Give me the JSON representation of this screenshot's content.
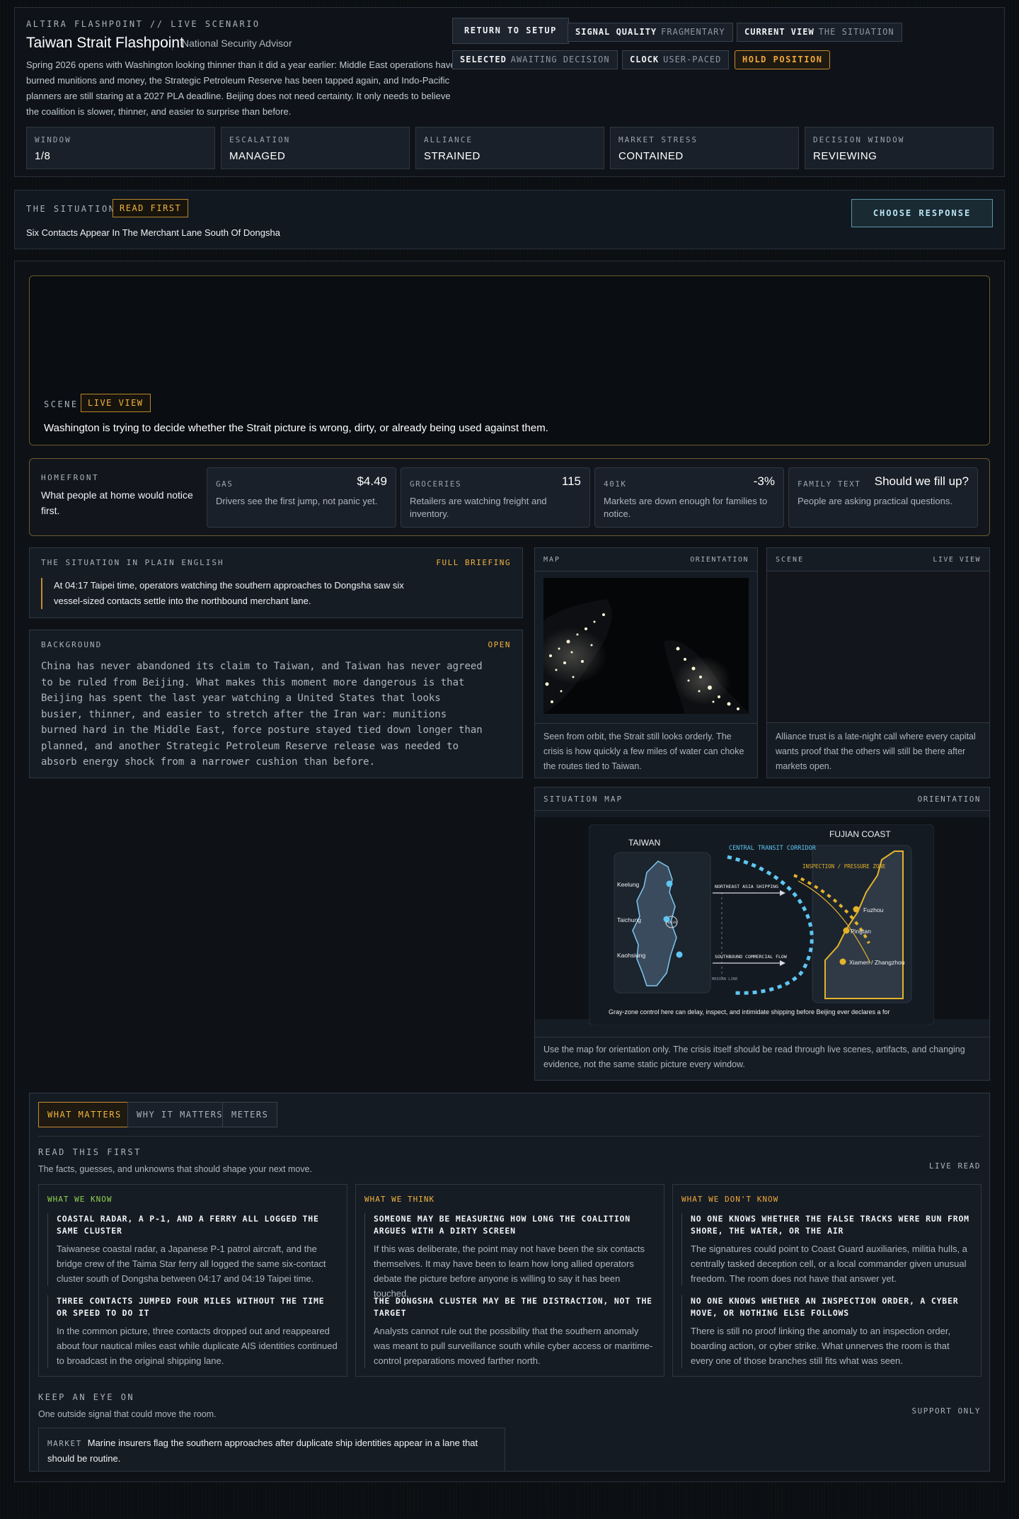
{
  "header": {
    "kicker": "ALTIRA FLASHPOINT // LIVE SCENARIO",
    "title": "Taiwan Strait Flashpoint",
    "role": "National Security Advisor",
    "intro": "Spring 2026 opens with Washington looking thinner than it did a year earlier: Middle East operations have burned munitions and money, the Strategic Petroleum Reserve has been tapped again, and Indo-Pacific planners are still staring at a 2027 PLA deadline. Beijing does not need certainty. It only needs to believe the coalition is slower, thinner, and easier to surprise than before.",
    "return_button": "RETURN TO SETUP",
    "chips": {
      "signal_quality": {
        "label": "SIGNAL QUALITY",
        "value": "FRAGMENTARY"
      },
      "current_view": {
        "label": "CURRENT VIEW",
        "value": "THE SITUATION"
      },
      "selected": {
        "label": "SELECTED",
        "value": "AWAITING DECISION"
      },
      "clock": {
        "label": "CLOCK",
        "value": "USER-PACED"
      }
    },
    "hold_button": "HOLD POSITION",
    "stats": [
      {
        "label": "WINDOW",
        "value": "1/8"
      },
      {
        "label": "ESCALATION",
        "value": "MANAGED"
      },
      {
        "label": "ALLIANCE",
        "value": "STRAINED"
      },
      {
        "label": "MARKET STRESS",
        "value": "CONTAINED"
      },
      {
        "label": "DECISION WINDOW",
        "value": "REVIEWING"
      }
    ]
  },
  "situation": {
    "label": "THE SITUATION",
    "tag": "READ FIRST",
    "headline": "Six Contacts Appear In The Merchant Lane South Of Dongsha",
    "choose_button": "CHOOSE RESPONSE"
  },
  "scene": {
    "label": "SCENE",
    "tag": "LIVE VIEW",
    "caption": "Washington is trying to decide whether the Strait picture is wrong, dirty, or already being used against them."
  },
  "homefront": {
    "label": "HOMEFRONT",
    "text": "What people at home would notice first.",
    "cards": [
      {
        "key": "GAS",
        "value": "$4.49",
        "desc": "Drivers see the first jump, not panic yet."
      },
      {
        "key": "GROCERIES",
        "value": "115",
        "desc": "Retailers are watching freight and inventory."
      },
      {
        "key": "401K",
        "value": "-3%",
        "desc": "Markets are down enough for families to notice."
      },
      {
        "key": "FAMILY TEXT",
        "value": "Should we fill up?",
        "desc": "People are asking practical questions."
      }
    ]
  },
  "plain_english": {
    "label": "THE SITUATION IN PLAIN ENGLISH",
    "link": "FULL BRIEFING",
    "text": "At 04:17 Taipei time, operators watching the southern approaches to Dongsha saw six vessel-sized contacts settle into the northbound merchant lane."
  },
  "background": {
    "label": "BACKGROUND",
    "link": "OPEN",
    "text": "China has never abandoned its claim to Taiwan, and Taiwan has never agreed to be ruled from Beijing. What makes this moment more dangerous is that Beijing has spent the last year watching a United States that looks busier, thinner, and easier to stretch after the Iran war: munitions burned hard in the Middle East, force posture stayed tied down longer than planned, and another Strategic Petroleum Reserve release was needed to absorb energy shock from a narrower cushion than before."
  },
  "map_card": {
    "label": "MAP",
    "right": "ORIENTATION",
    "caption": "Seen from orbit, the Strait still looks orderly. The crisis is how quickly a few miles of water can choke the routes tied to Taiwan."
  },
  "scene_card": {
    "label": "SCENE",
    "right": "LIVE VIEW",
    "caption": "Alliance trust is a late-night call where every capital wants proof that the others will still be there after markets open."
  },
  "situation_map": {
    "label": "SITUATION MAP",
    "right": "ORIENTATION",
    "taiwan": "TAIWAN",
    "fujian": "FUJIAN COAST",
    "corridor": "CENTRAL TRANSIT CORRIDOR",
    "inspection": "INSPECTION / PRESSURE ZONE",
    "ne_shipping": "NORTHEAST ASIA SHIPPING",
    "sb_shipping": "SOUTHBOUND COMMERCIAL FLOW",
    "median": "MEDIAN LINE",
    "penghu": "PENGHU",
    "cities_tw": [
      "Keelung",
      "Taichung",
      "Kaohsiung"
    ],
    "cities_cn": [
      "Fuzhou",
      "Pingtan",
      "Xiamen / Zhangzhou"
    ],
    "footer": "Gray-zone control here can delay, inspect, and intimidate shipping before Beijing ever declares a for",
    "caption": "Use the map for orientation only. The crisis itself should be read through live scenes, artifacts, and changing evidence, not the same static picture every window."
  },
  "tabs": [
    "WHAT MATTERS",
    "WHY IT MATTERS",
    "METERS"
  ],
  "read_first": {
    "title": "READ THIS FIRST",
    "sub": "The facts, guesses, and unknowns that should shape your next move.",
    "right": "LIVE READ"
  },
  "columns": [
    {
      "header": "WHAT WE KNOW",
      "color": "#8fd14f",
      "items": [
        {
          "title": "COASTAL RADAR, A P-1, AND A FERRY ALL LOGGED THE SAME CLUSTER",
          "body": "Taiwanese coastal radar, a Japanese P-1 patrol aircraft, and the bridge crew of the Taima Star ferry all logged the same six-contact cluster south of Dongsha between 04:17 and 04:19 Taipei time."
        },
        {
          "title": "THREE CONTACTS JUMPED FOUR MILES WITHOUT THE TIME OR SPEED TO DO IT",
          "body": "In the common picture, three contacts dropped out and reappeared about four nautical miles east while duplicate AIS identities continued to broadcast in the original shipping lane."
        }
      ]
    },
    {
      "header": "WHAT WE THINK",
      "color": "#f2b33c",
      "items": [
        {
          "title": "SOMEONE MAY BE MEASURING HOW LONG THE COALITION ARGUES WITH A DIRTY SCREEN",
          "body": "If this was deliberate, the point may not have been the six contacts themselves. It may have been to learn how long allied operators debate the picture before anyone is willing to say it has been touched."
        },
        {
          "title": "THE DONGSHA CLUSTER MAY BE THE DISTRACTION, NOT THE TARGET",
          "body": "Analysts cannot rule out the possibility that the southern anomaly was meant to pull surveillance south while cyber access or maritime-control preparations moved farther north."
        }
      ]
    },
    {
      "header": "WHAT WE DON'T KNOW",
      "color": "#f0a83a",
      "items": [
        {
          "title": "NO ONE KNOWS WHETHER THE FALSE TRACKS WERE RUN FROM SHORE, THE WATER, OR THE AIR",
          "body": "The signatures could point to Coast Guard auxiliaries, militia hulls, a centrally tasked deception cell, or a local commander given unusual freedom. The room does not have that answer yet."
        },
        {
          "title": "NO ONE KNOWS WHETHER AN INSPECTION ORDER, A CYBER MOVE, OR NOTHING ELSE FOLLOWS",
          "body": "There is still no proof linking the anomaly to an inspection order, boarding action, or cyber strike. What unnerves the room is that every one of those branches still fits what was seen."
        }
      ]
    }
  ],
  "keep_eye": {
    "title": "KEEP AN EYE ON",
    "sub": "One outside signal that could move the room.",
    "right": "SUPPORT ONLY",
    "tag": "MARKET",
    "text": "Marine insurers flag the southern approaches after duplicate ship identities appear in a lane that should be routine."
  },
  "colors": {
    "accent": "#f2b33c",
    "cyan": "#5ec6f2",
    "background": "#0b0e12"
  }
}
